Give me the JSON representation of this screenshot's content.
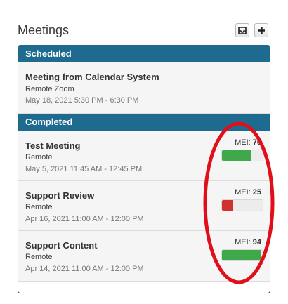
{
  "header": {
    "title": "Meetings",
    "inbox_icon": "inbox-icon",
    "add_icon": "plus-icon"
  },
  "scheduled": {
    "label": "Scheduled",
    "items": [
      {
        "title": "Meeting from Calendar System",
        "location": "Remote Zoom",
        "date": "May 18, 2021 5:30 PM - 6:30 PM"
      }
    ]
  },
  "completed": {
    "label": "Completed",
    "mei_label": "MEI:",
    "items": [
      {
        "title": "Test Meeting",
        "location": "Remote",
        "date": "May 5, 2021 11:45 AM - 12:45 PM",
        "mei": 70,
        "mei_color": "#3fa84a"
      },
      {
        "title": "Support Review",
        "location": "Remote",
        "date": "Apr 16, 2021 11:00 AM - 12:00 PM",
        "mei": 25,
        "mei_color": "#d2322d"
      },
      {
        "title": "Support Content",
        "location": "Remote",
        "date": "Apr 14, 2021 11:00 AM - 12:00 PM",
        "mei": 94,
        "mei_color": "#3fa84a"
      }
    ]
  },
  "colors": {
    "header_bg": "#1e6b8f",
    "annotation": "#e0101a"
  }
}
